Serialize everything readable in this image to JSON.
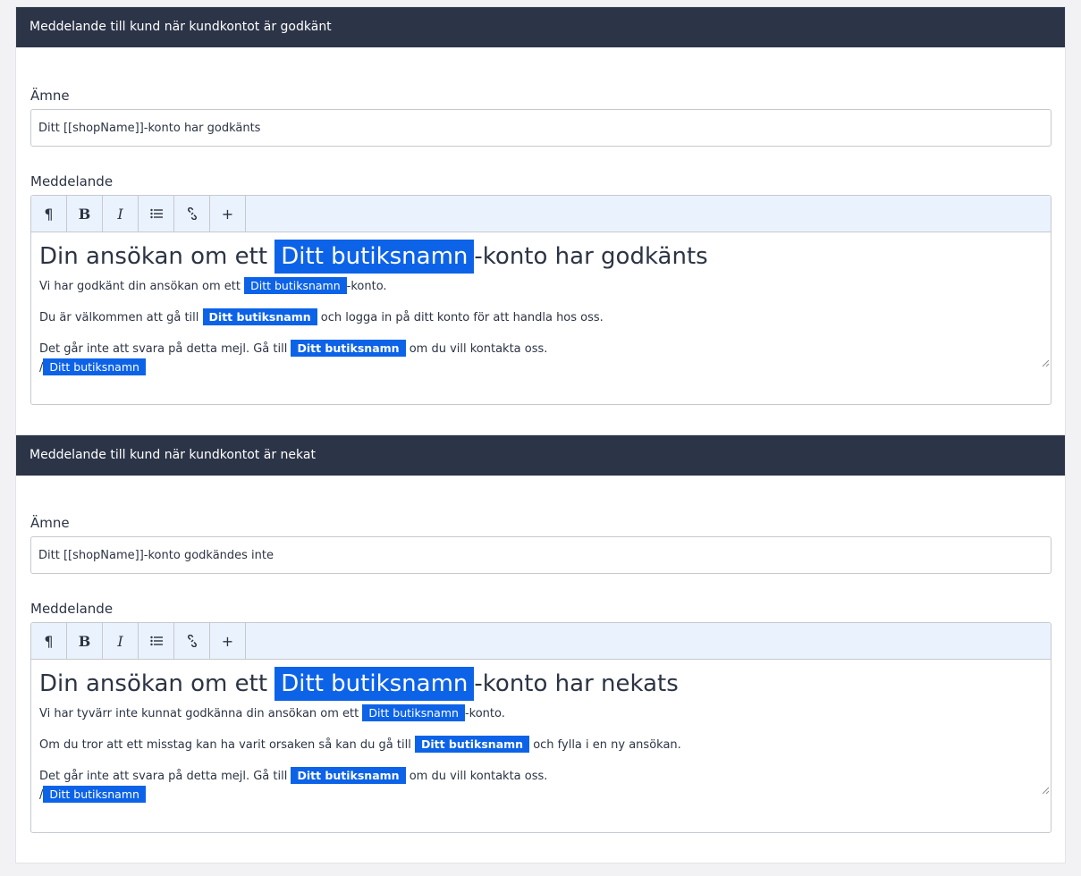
{
  "sections": [
    {
      "header": "Meddelande till kund när kundkontot är godkänt",
      "subject_label": "Ämne",
      "subject_value": "Ditt [[shopName]]-konto har godkänts",
      "message_label": "Meddelande",
      "heading_pre": "Din ansökan om ett ",
      "heading_tag": "Ditt butiksnamn",
      "heading_post": "-konto har godkänts",
      "p1_pre": "Vi har godkänt din ansökan om ett ",
      "p1_tag": "Ditt butiksnamn",
      "p1_post": "-konto.",
      "p2_pre": "Du är välkommen att gå till ",
      "p2_tag": "Ditt butiksnamn",
      "p2_post": " och logga in på ditt konto för att handla hos oss.",
      "p3_pre": "Det går inte att svara på detta mejl. Gå till ",
      "p3_tag": "Ditt butiksnamn",
      "p3_post": " om du vill kontakta oss.",
      "sig_pre": "/",
      "sig_tag": "Ditt butiksnamn"
    },
    {
      "header": "Meddelande till kund när kundkontot är nekat",
      "subject_label": "Ämne",
      "subject_value": "Ditt [[shopName]]-konto godkändes inte",
      "message_label": "Meddelande",
      "heading_pre": "Din ansökan om ett ",
      "heading_tag": "Ditt butiksnamn",
      "heading_post": "-konto har nekats",
      "p1_pre": "Vi har tyvärr inte kunnat godkänna din ansökan om ett ",
      "p1_tag": "Ditt butiksnamn",
      "p1_post": "-konto.",
      "p2_pre": "Om du tror att ett misstag kan ha varit orsaken så kan du gå till ",
      "p2_tag": "Ditt butiksnamn",
      "p2_post": " och fylla i en ny ansökan.",
      "p3_pre": "Det går inte att svara på detta mejl. Gå till ",
      "p3_tag": "Ditt butiksnamn",
      "p3_post": " om du vill kontakta oss.",
      "sig_pre": "/",
      "sig_tag": "Ditt butiksnamn"
    }
  ],
  "toolbar": {
    "paragraph_icon": "¶",
    "bold_icon": "B",
    "italic_icon": "I",
    "plus_icon": "+"
  },
  "colors": {
    "header_bg": "#2c3447",
    "tag_bg": "#0d63e8",
    "toolbar_bg": "#eaf2fd"
  }
}
